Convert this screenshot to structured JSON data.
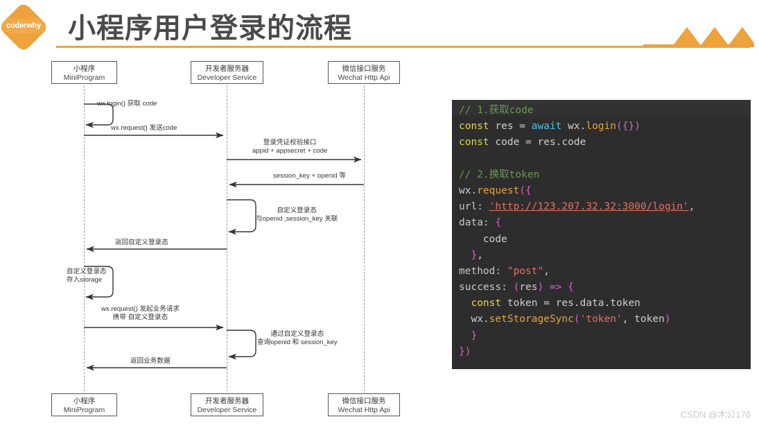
{
  "header": {
    "logo_label": "coderwhy",
    "title": "小程序用户登录的流程",
    "decoration_icon": "mountain-peaks-icon"
  },
  "diagram": {
    "type": "sequence-diagram",
    "participants": [
      {
        "cn": "小程序",
        "en": "MiniProgram"
      },
      {
        "cn": "开发者服务器",
        "en": "Developer Service"
      },
      {
        "cn": "微信接口服务",
        "en": "Wechat Http Api"
      }
    ],
    "messages": [
      {
        "line1": "wx.login() 获取 code",
        "line2": "",
        "kind": "self",
        "from": 0,
        "to": 0
      },
      {
        "line1": "wx.request() 发送code",
        "line2": "",
        "kind": "right",
        "from": 0,
        "to": 1
      },
      {
        "line1": "登录凭证校验接口",
        "line2": "appid + appsecret + code",
        "kind": "right",
        "from": 1,
        "to": 2
      },
      {
        "line1": "session_key + openid 等",
        "line2": "",
        "kind": "left",
        "from": 2,
        "to": 1
      },
      {
        "line1": "自定义登录态",
        "line2": "与openid ,session_key 关联",
        "kind": "self",
        "from": 1,
        "to": 1
      },
      {
        "line1": "返回自定义登录态",
        "line2": "",
        "kind": "left",
        "from": 1,
        "to": 0
      },
      {
        "line1": "自定义登录态",
        "line2": "存入storage",
        "kind": "self",
        "from": 0,
        "to": 0
      },
      {
        "line1": "wx.request() 发起业务请求",
        "line2": "携带 自定义登录态",
        "kind": "right",
        "from": 0,
        "to": 1
      },
      {
        "line1": "通过自定义登录态",
        "line2": "查询openid 和 session_key",
        "kind": "self",
        "from": 1,
        "to": 1
      },
      {
        "line1": "返回业务数据",
        "line2": "",
        "kind": "left",
        "from": 1,
        "to": 0
      }
    ]
  },
  "code": {
    "language": "javascript",
    "background_color": "#2d2d2d",
    "lines": [
      "// 1.获取code",
      "const res = await wx.login({})",
      "const code = res.code",
      "",
      "// 2.换取token",
      "wx.request({",
      "  url: 'http://123.207.32.32:3000/login',",
      "  data: {",
      "    code",
      "  },",
      "  method: \"post\",",
      "  success: (res) => {",
      "    const token = res.data.token",
      "    wx.setStorageSync('token', token)",
      "  }",
      "})"
    ],
    "tokens": {
      "comment1": "// 1.获取code",
      "comment2": "// 2.换取token",
      "kw_const": "const",
      "kw_await": "await",
      "fn_login": "login",
      "fn_request": "request",
      "fn_setStorageSync": "setStorageSync",
      "url_value": "'http://123.207.32.32:3000/login'",
      "str_post": "\"post\"",
      "str_token": "'token'",
      "prop_url": "url:",
      "prop_data": "data:",
      "prop_method": "method:",
      "prop_success": "success:"
    }
  },
  "watermark": "CSDN @木公176"
}
